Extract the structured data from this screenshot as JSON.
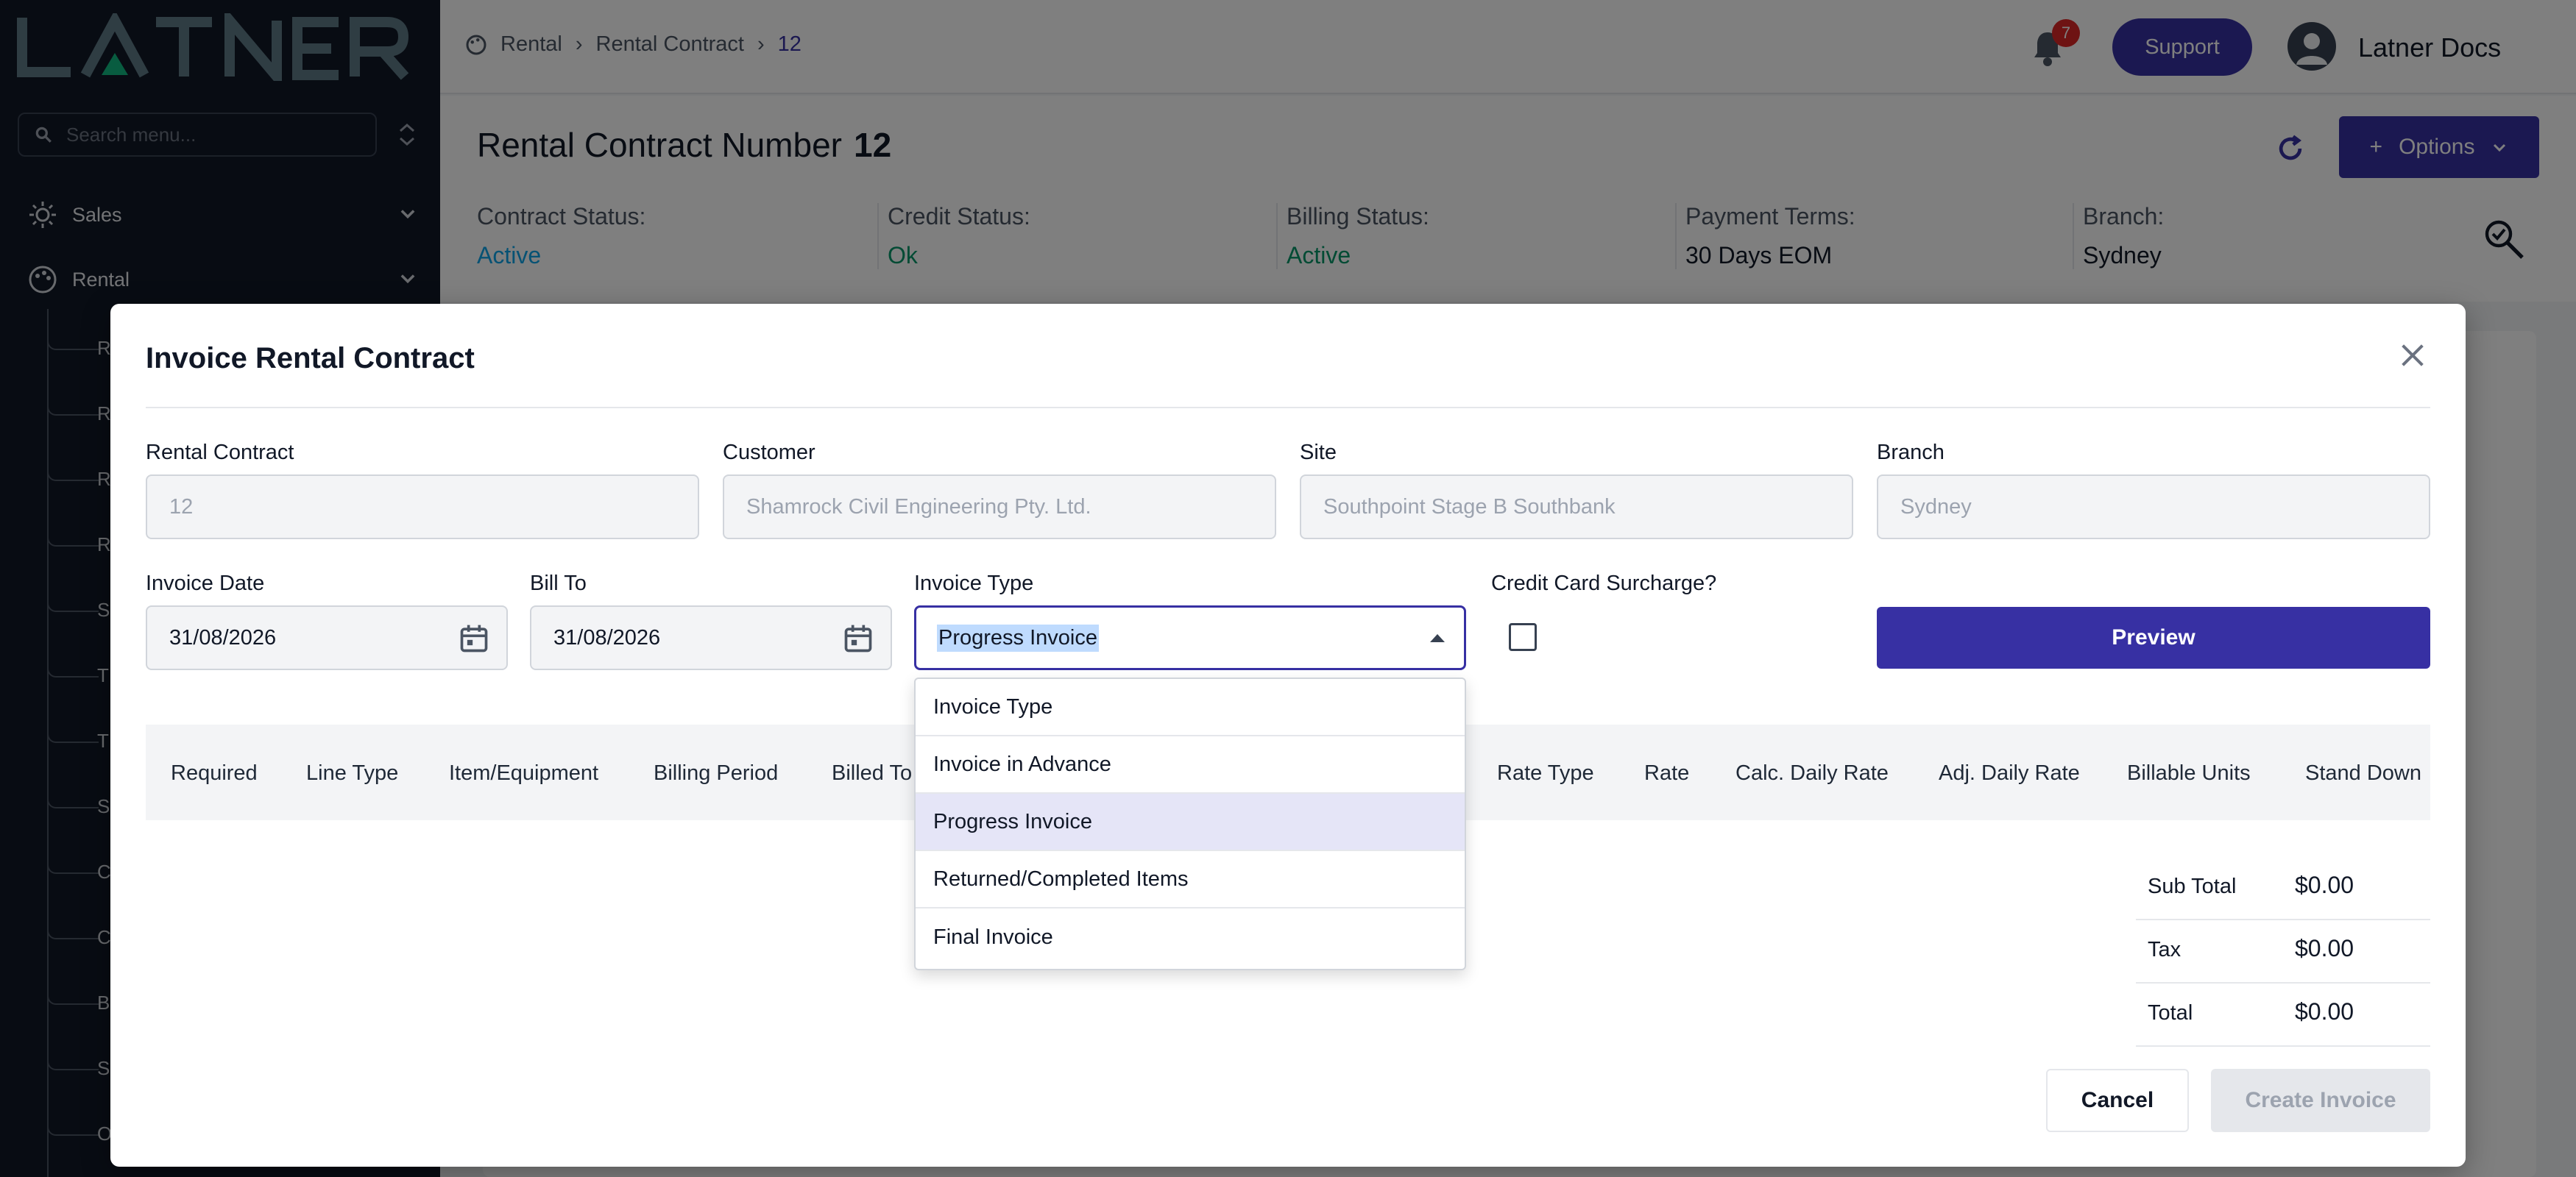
{
  "sidebar": {
    "logo_text": "LATNER",
    "search_placeholder": "Search menu...",
    "items": [
      {
        "label": "Sales",
        "icon": "sun-icon"
      },
      {
        "label": "Rental",
        "icon": "palette-icon"
      }
    ],
    "sub_items_visible_initials": [
      "R",
      "R",
      "R",
      "R",
      "S",
      "T",
      "T",
      "S",
      "C",
      "C",
      "B",
      "S",
      "O"
    ]
  },
  "topbar": {
    "breadcrumbs": [
      "Rental",
      "Rental Contract",
      "12"
    ],
    "notification_count": "7",
    "support_label": "Support",
    "user_name": "Latner Docs"
  },
  "page": {
    "title": "Rental Contract Number",
    "number": "12",
    "options_label": "Options",
    "stats": [
      {
        "label": "Contract Status:",
        "value": "Active",
        "color": "#0ea5e9"
      },
      {
        "label": "Credit Status:",
        "value": "Ok",
        "color": "#059669"
      },
      {
        "label": "Billing Status:",
        "value": "Active",
        "color": "#059669"
      },
      {
        "label": "Payment Terms:",
        "value": "30 Days EOM",
        "color": "#111827"
      },
      {
        "label": "Branch:",
        "value": "Sydney",
        "color": "#111827"
      }
    ]
  },
  "modal": {
    "title": "Invoice Rental Contract",
    "fields": {
      "rental_contract": {
        "label": "Rental Contract",
        "value": "12"
      },
      "customer": {
        "label": "Customer",
        "value": "Shamrock Civil Engineering Pty. Ltd."
      },
      "site": {
        "label": "Site",
        "value": "Southpoint Stage B Southbank"
      },
      "branch": {
        "label": "Branch",
        "value": "Sydney"
      },
      "invoice_date": {
        "label": "Invoice Date",
        "value": "31/08/2026"
      },
      "bill_to": {
        "label": "Bill To",
        "value": "31/08/2026"
      },
      "invoice_type": {
        "label": "Invoice Type",
        "value": "Progress Invoice"
      },
      "credit_card_surcharge": {
        "label": "Credit Card Surcharge?",
        "checked": false
      }
    },
    "preview_label": "Preview",
    "dropdown_options": [
      "Invoice Type",
      "Invoice in Advance",
      "Progress Invoice",
      "Returned/Completed Items",
      "Final Invoice"
    ],
    "selected_option": "Progress Invoice",
    "table_columns": [
      "Required",
      "Line Type",
      "Item/Equipment",
      "Billing Period",
      "Billed To",
      "Rate Type",
      "Rate",
      "Calc. Daily Rate",
      "Adj. Daily Rate",
      "Billable Units",
      "Stand Down"
    ],
    "totals": [
      {
        "label": "Sub Total",
        "value": "$0.00"
      },
      {
        "label": "Tax",
        "value": "$0.00"
      },
      {
        "label": "Total",
        "value": "$0.00"
      }
    ],
    "cancel_label": "Cancel",
    "create_label": "Create Invoice"
  },
  "colors": {
    "primary": "#3730a3",
    "sidebar_bg": "#111827",
    "badge": "#dc2626"
  }
}
